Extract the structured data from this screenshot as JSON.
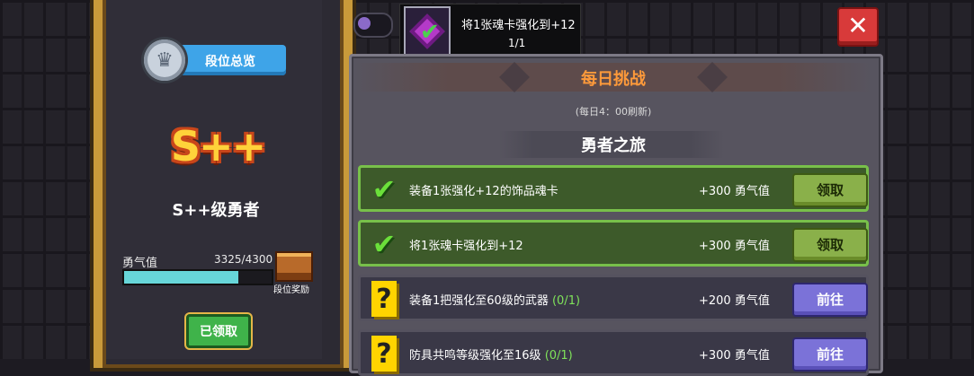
{
  "rank_panel": {
    "overview_label": "段位总览",
    "rank_badge_text": "S++",
    "rank_name": "S++级勇者",
    "courage_label": "勇气值",
    "courage_value": "3325/4300",
    "courage_progress": 0.773,
    "reward_label": "段位奖励",
    "claimed_label": "已领取"
  },
  "top_bar": {
    "task_title": "将1张魂卡强化到+12",
    "task_progress": "1/1",
    "close_icon": "✕"
  },
  "challenge": {
    "title": "每日挑战",
    "refresh_note": "(每日4：00刷新)",
    "section_title": "勇者之旅",
    "tasks": [
      {
        "text": "装备1张强化+12的饰品魂卡",
        "count": "",
        "reward": "+300 勇气值",
        "button": "领取",
        "status": "done"
      },
      {
        "text": "将1张魂卡强化到+12",
        "count": "",
        "reward": "+300 勇气值",
        "button": "领取",
        "status": "done"
      },
      {
        "text": "装备1把强化至60级的武器",
        "count": "(0/1)",
        "reward": "+200 勇气值",
        "button": "前往",
        "status": "todo"
      },
      {
        "text": "防具共鸣等级强化至16级",
        "count": "(0/1)",
        "reward": "+300 勇气值",
        "button": "前往",
        "status": "todo"
      }
    ]
  },
  "colors": {
    "done_border": "#78c04a",
    "claim_button": "#8ab04a",
    "go_button": "#7b72d8",
    "title_orange": "#ff9a3a",
    "courage_bar": "#67d6d9"
  }
}
